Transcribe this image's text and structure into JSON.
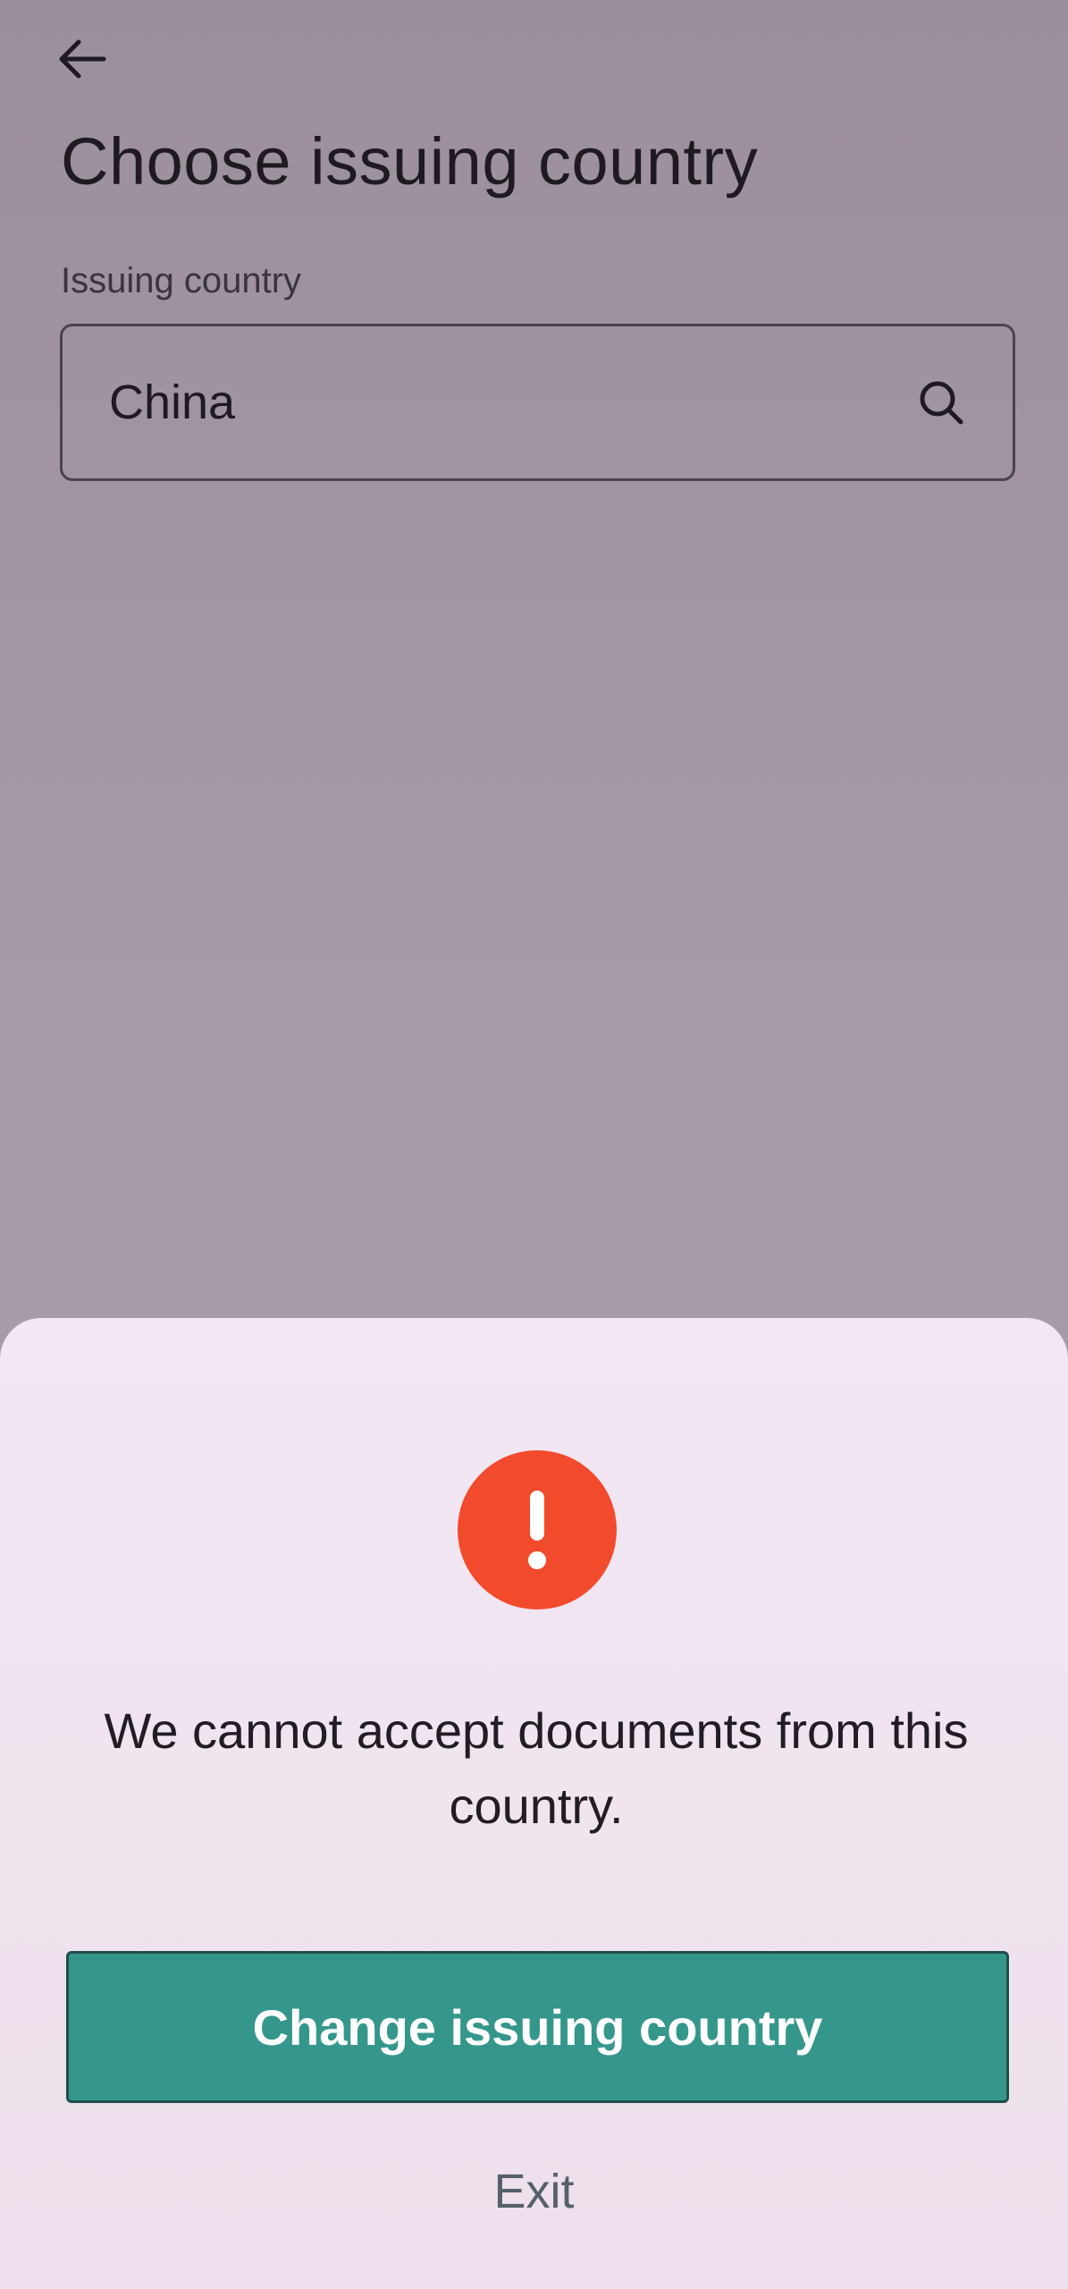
{
  "header": {
    "back_icon": "arrow-left-icon",
    "title": "Choose issuing country"
  },
  "form": {
    "label": "Issuing country",
    "value": "China",
    "search_icon": "search-icon"
  },
  "dialog": {
    "icon": "alert-exclamation-icon",
    "icon_color": "#f24a2c",
    "message": "We cannot accept documents from this country.",
    "primary_button": "Change issuing country",
    "primary_color": "#35978c",
    "secondary_link": "Exit"
  }
}
